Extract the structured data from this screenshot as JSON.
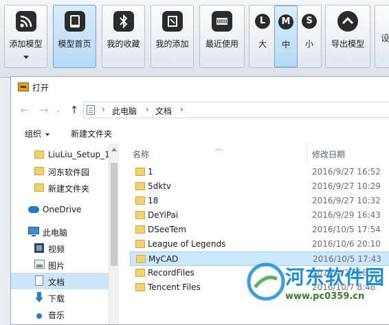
{
  "toolbar": {
    "buttons": [
      {
        "label": "添加模型",
        "icon": "rss-icon",
        "has_dropdown": true
      },
      {
        "label": "模型首页",
        "icon": "home-tablet-icon",
        "active": true
      },
      {
        "label": "我的收藏",
        "icon": "bluetooth-icon"
      },
      {
        "label": "我的添加",
        "icon": "pin-icon"
      },
      {
        "label": "最近使用",
        "icon": "clock-icon"
      }
    ],
    "size_group": [
      {
        "label": "大",
        "letter": "L"
      },
      {
        "label": "中",
        "letter": "M",
        "active": true
      },
      {
        "label": "小",
        "letter": "S"
      }
    ],
    "export": {
      "label": "导出模型",
      "icon": "export-icon"
    },
    "extra_fragment": "设"
  },
  "dialog": {
    "title": "打开",
    "nav": {
      "back": "←",
      "forward": "→",
      "dropdown": "⌄",
      "up": "↑"
    },
    "address": {
      "segments": [
        "此电脑",
        "文档"
      ],
      "separator": "›"
    },
    "commands": {
      "organize": "组织",
      "new_folder": "新建文件夹"
    },
    "sidebar": {
      "items": [
        {
          "label": "LiuLiu_Setup_1.",
          "icon": "folder-icon",
          "indent": 1
        },
        {
          "label": "河东软件园",
          "icon": "folder-icon",
          "indent": 1
        },
        {
          "label": "新建文件夹",
          "icon": "folder-icon",
          "indent": 1
        },
        {
          "label": "OneDrive",
          "icon": "cloud-icon",
          "indent": 0
        },
        {
          "label": "此电脑",
          "icon": "computer-icon",
          "indent": 0
        },
        {
          "label": "视频",
          "icon": "video-icon",
          "indent": 1
        },
        {
          "label": "图片",
          "icon": "picture-icon",
          "indent": 1
        },
        {
          "label": "文档",
          "icon": "document-icon",
          "indent": 1,
          "selected": true
        },
        {
          "label": "下载",
          "icon": "download-icon",
          "indent": 1
        },
        {
          "label": "音乐",
          "icon": "music-icon",
          "indent": 1
        }
      ]
    },
    "columns": {
      "name": "名称",
      "date": "修改日期"
    },
    "files": [
      {
        "name": "1",
        "date": "2016/9/27 16:52"
      },
      {
        "name": "5dktv",
        "date": "2016/9/27 10:29"
      },
      {
        "name": "18",
        "date": "2016/9/27 10:32"
      },
      {
        "name": "DeYiPai",
        "date": "2016/9/29 16:43"
      },
      {
        "name": "DSeeTem",
        "date": "2016/10/5 17:54"
      },
      {
        "name": "League of Legends",
        "date": "2016/10/6 20:10"
      },
      {
        "name": "MyCAD",
        "date": "2016/10/5 17:43",
        "selected": true
      },
      {
        "name": "RecordFiles",
        "date": "2016/9/28 18:07"
      },
      {
        "name": "Tencent Files",
        "date": "2016/10/7 8:46"
      }
    ]
  },
  "watermark": {
    "title": "河东软件园",
    "url": "www.pc0359.cn"
  },
  "colors": {
    "accent": "#1a8fd8",
    "selection": "#cce8ff",
    "folder": "#f3d16e"
  }
}
